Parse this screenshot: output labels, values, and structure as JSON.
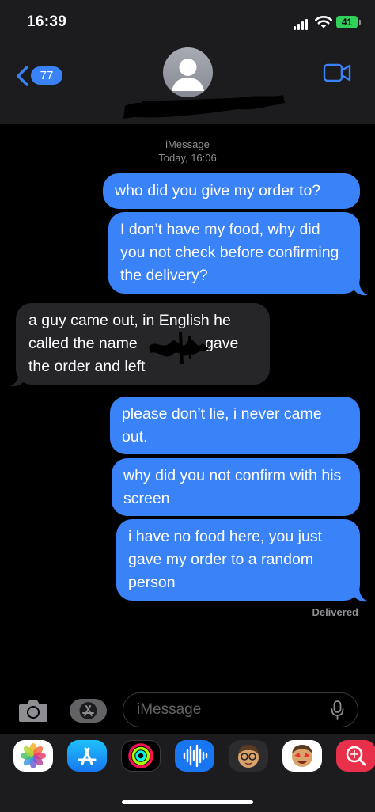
{
  "status_bar": {
    "time": "16:39",
    "battery": "41"
  },
  "header": {
    "back_count": "77"
  },
  "thread_meta": {
    "service": "iMessage",
    "timestamp": "Today, 16:06"
  },
  "messages": [
    {
      "direction": "outgoing",
      "text": "who did you give my order to?"
    },
    {
      "direction": "outgoing",
      "text": "I don’t have my food, why did you not check before confirming the delivery?"
    },
    {
      "direction": "incoming",
      "text_before": " a guy came out, in English he called the name",
      "text_after": " gave the order and left"
    },
    {
      "direction": "outgoing",
      "text": "please don’t lie, i never came out."
    },
    {
      "direction": "outgoing",
      "text": "why did you not confirm with his screen"
    },
    {
      "direction": "outgoing",
      "text": "i have no food here, you just gave my order to a random person"
    }
  ],
  "delivery_status": "Delivered",
  "composer": {
    "placeholder": "iMessage"
  },
  "app_tray": [
    "photos-icon",
    "app-store-icon",
    "activity-icon",
    "audio-message-icon",
    "memoji-icon",
    "memoji-stickers-icon",
    "web-search-icon"
  ],
  "colors": {
    "outgoing_bubble": "#3a82f7",
    "incoming_bubble": "#262629",
    "background": "#000000",
    "header": "#1c1c1e"
  }
}
